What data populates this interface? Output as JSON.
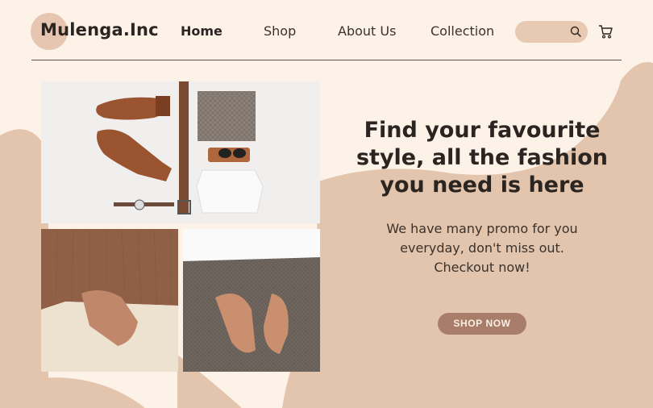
{
  "header": {
    "logo": "Mulenga.Inc",
    "nav": [
      "Home",
      "Shop",
      "About Us",
      "Collection"
    ],
    "active_nav": "Home",
    "search": {
      "placeholder": "",
      "icon": "search-icon"
    },
    "cart": {
      "icon": "cart-icon"
    }
  },
  "hero": {
    "title": "Find your favourite style, all the fashion you need is here",
    "subtitle": "We have many promo for you everyday, don't miss out. Checkout now!",
    "cta_label": "SHOP NOW"
  },
  "colors": {
    "background": "#fdf2e8",
    "blob": "#e3c4ad",
    "accent_button": "#a87e6a",
    "search_bg": "#e8c9b2",
    "text": "#2b2521"
  },
  "images": [
    "flat-lay outfit photo",
    "ribbed top and cream jeans photo",
    "white top and checked trousers photo"
  ]
}
